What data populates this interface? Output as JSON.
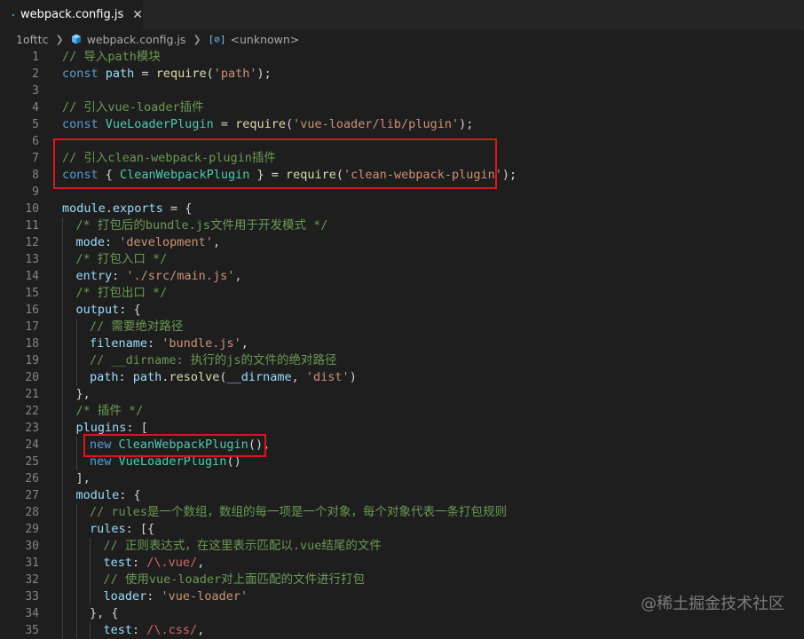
{
  "tab": {
    "label": "webpack.config.js",
    "close_glyph": "✕",
    "icon": "cube-icon"
  },
  "breadcrumb": {
    "items": [
      "1ofttc",
      "webpack.config.js",
      "<unknown>"
    ],
    "symbol_glyph": "[⊘]"
  },
  "watermark": "@稀土掘金技术社区",
  "highlight_color": "#e0141e",
  "lines": [
    {
      "n": "1",
      "indent": 0,
      "tokens": [
        [
          "c",
          "// 导入path模块"
        ]
      ]
    },
    {
      "n": "2",
      "indent": 0,
      "tokens": [
        [
          "k",
          "const "
        ],
        [
          "v",
          "path"
        ],
        [
          "p",
          " = "
        ],
        [
          "f",
          "require"
        ],
        [
          "p",
          "("
        ],
        [
          "s",
          "'path'"
        ],
        [
          "p",
          ");"
        ]
      ]
    },
    {
      "n": "3",
      "indent": 0,
      "tokens": []
    },
    {
      "n": "4",
      "indent": 0,
      "tokens": [
        [
          "c",
          "// 引入vue-loader插件"
        ]
      ]
    },
    {
      "n": "5",
      "indent": 0,
      "tokens": [
        [
          "k",
          "const "
        ],
        [
          "cl",
          "VueLoaderPlugin"
        ],
        [
          "p",
          " = "
        ],
        [
          "f",
          "require"
        ],
        [
          "p",
          "("
        ],
        [
          "s",
          "'vue-loader/lib/plugin'"
        ],
        [
          "p",
          ");"
        ]
      ]
    },
    {
      "n": "6",
      "indent": 0,
      "tokens": []
    },
    {
      "n": "7",
      "indent": 0,
      "tokens": [
        [
          "c",
          "// 引入clean-webpack-plugin插件"
        ]
      ]
    },
    {
      "n": "8",
      "indent": 0,
      "tokens": [
        [
          "k",
          "const "
        ],
        [
          "p",
          "{ "
        ],
        [
          "cl",
          "CleanWebpackPlugin"
        ],
        [
          "p",
          " } = "
        ],
        [
          "f",
          "require"
        ],
        [
          "p",
          "("
        ],
        [
          "s",
          "'clean-webpack-plugin'"
        ],
        [
          "p",
          ");"
        ]
      ]
    },
    {
      "n": "9",
      "indent": 0,
      "tokens": []
    },
    {
      "n": "10",
      "indent": 0,
      "tokens": [
        [
          "v",
          "module"
        ],
        [
          "p",
          "."
        ],
        [
          "v",
          "exports"
        ],
        [
          "p",
          " = {"
        ]
      ]
    },
    {
      "n": "11",
      "indent": 1,
      "tokens": [
        [
          "c",
          "/* 打包后的bundle.js文件用于开发模式 */"
        ]
      ]
    },
    {
      "n": "12",
      "indent": 1,
      "tokens": [
        [
          "v",
          "mode"
        ],
        [
          "p",
          ": "
        ],
        [
          "s",
          "'development'"
        ],
        [
          "p",
          ","
        ]
      ]
    },
    {
      "n": "13",
      "indent": 1,
      "tokens": [
        [
          "c",
          "/* 打包入口 */"
        ]
      ]
    },
    {
      "n": "14",
      "indent": 1,
      "tokens": [
        [
          "v",
          "entry"
        ],
        [
          "p",
          ": "
        ],
        [
          "s",
          "'./src/main.js'"
        ],
        [
          "p",
          ","
        ]
      ]
    },
    {
      "n": "15",
      "indent": 1,
      "tokens": [
        [
          "c",
          "/* 打包出口 */"
        ]
      ]
    },
    {
      "n": "16",
      "indent": 1,
      "tokens": [
        [
          "v",
          "output"
        ],
        [
          "p",
          ": {"
        ]
      ]
    },
    {
      "n": "17",
      "indent": 2,
      "tokens": [
        [
          "c",
          "// 需要绝对路径"
        ]
      ]
    },
    {
      "n": "18",
      "indent": 2,
      "tokens": [
        [
          "v",
          "filename"
        ],
        [
          "p",
          ": "
        ],
        [
          "s",
          "'bundle.js'"
        ],
        [
          "p",
          ","
        ]
      ]
    },
    {
      "n": "19",
      "indent": 2,
      "tokens": [
        [
          "c",
          "// __dirname: 执行的js的文件的绝对路径"
        ]
      ]
    },
    {
      "n": "20",
      "indent": 2,
      "tokens": [
        [
          "v",
          "path"
        ],
        [
          "p",
          ": "
        ],
        [
          "v",
          "path"
        ],
        [
          "p",
          "."
        ],
        [
          "f",
          "resolve"
        ],
        [
          "p",
          "("
        ],
        [
          "v",
          "__dirname"
        ],
        [
          "p",
          ", "
        ],
        [
          "s",
          "'dist'"
        ],
        [
          "p",
          ")"
        ]
      ]
    },
    {
      "n": "21",
      "indent": 1,
      "tokens": [
        [
          "p",
          "},"
        ]
      ]
    },
    {
      "n": "22",
      "indent": 1,
      "tokens": [
        [
          "c",
          "/* 插件 */"
        ]
      ]
    },
    {
      "n": "23",
      "indent": 1,
      "tokens": [
        [
          "v",
          "plugins"
        ],
        [
          "p",
          ": ["
        ]
      ]
    },
    {
      "n": "24",
      "indent": 2,
      "tokens": [
        [
          "k",
          "new "
        ],
        [
          "cl",
          "CleanWebpackPlugin"
        ],
        [
          "p",
          "(),"
        ]
      ]
    },
    {
      "n": "25",
      "indent": 2,
      "tokens": [
        [
          "k",
          "new "
        ],
        [
          "cl",
          "VueLoaderPlugin"
        ],
        [
          "p",
          "()"
        ]
      ]
    },
    {
      "n": "26",
      "indent": 1,
      "tokens": [
        [
          "p",
          "],"
        ]
      ]
    },
    {
      "n": "27",
      "indent": 1,
      "tokens": [
        [
          "v",
          "module"
        ],
        [
          "p",
          ": {"
        ]
      ]
    },
    {
      "n": "28",
      "indent": 2,
      "tokens": [
        [
          "c",
          "// rules是一个数组，数组的每一项是一个对象，每个对象代表一条打包规则"
        ]
      ]
    },
    {
      "n": "29",
      "indent": 2,
      "tokens": [
        [
          "v",
          "rules"
        ],
        [
          "p",
          ": [{"
        ]
      ]
    },
    {
      "n": "30",
      "indent": 3,
      "tokens": [
        [
          "c",
          "// 正则表达式，在这里表示匹配以.vue结尾的文件"
        ]
      ]
    },
    {
      "n": "31",
      "indent": 3,
      "tokens": [
        [
          "v",
          "test"
        ],
        [
          "p",
          ": "
        ],
        [
          "r",
          "/\\.vue/"
        ],
        [
          "p",
          ","
        ]
      ]
    },
    {
      "n": "32",
      "indent": 3,
      "tokens": [
        [
          "c",
          "// 使用vue-loader对上面匹配的文件进行打包"
        ]
      ]
    },
    {
      "n": "33",
      "indent": 3,
      "tokens": [
        [
          "v",
          "loader"
        ],
        [
          "p",
          ": "
        ],
        [
          "s",
          "'vue-loader'"
        ]
      ]
    },
    {
      "n": "34",
      "indent": 2,
      "tokens": [
        [
          "p",
          "}, {"
        ]
      ]
    },
    {
      "n": "35",
      "indent": 3,
      "tokens": [
        [
          "v",
          "test"
        ],
        [
          "p",
          ": "
        ],
        [
          "r",
          "/\\.css/"
        ],
        [
          "p",
          ","
        ]
      ]
    }
  ]
}
